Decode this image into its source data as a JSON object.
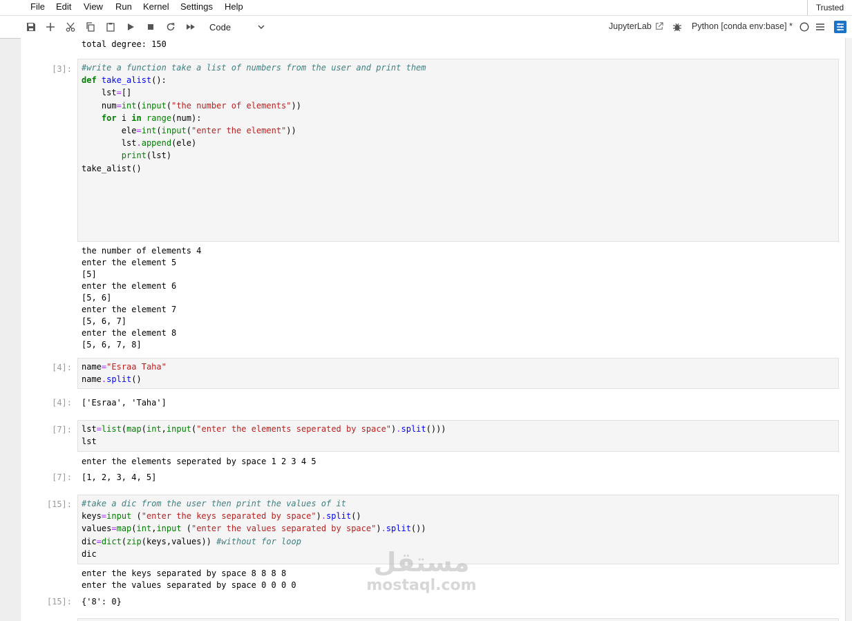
{
  "menu": [
    "File",
    "Edit",
    "View",
    "Run",
    "Kernel",
    "Settings",
    "Help"
  ],
  "trusted": "Trusted",
  "toolbar": {
    "cell_type": "Code",
    "jupyterlab": "JupyterLab",
    "kernel": "Python [conda env:base] *"
  },
  "cells": {
    "prev_output": "total degree: 150",
    "c3_prompt": "[3]:",
    "c3_output": [
      "the number of elements 4",
      "enter the element 5",
      "[5]",
      "enter the element 6",
      "[5, 6]",
      "enter the element 7",
      "[5, 6, 7]",
      "enter the element 8",
      "[5, 6, 7, 8]"
    ],
    "c4_prompt": "[4]:",
    "c4_out_prompt": "[4]:",
    "c4_result": "['Esraa', 'Taha']",
    "c7_prompt": "[7]:",
    "c7_stdout": "enter the elements seperated by space 1 2 3 4 5",
    "c7_out_prompt": "[7]:",
    "c7_result": "[1, 2, 3, 4, 5]",
    "c15_prompt": "[15]:",
    "c15_stdout": [
      "enter the keys separated by space 8 8 8 8",
      "enter the values separated by space 0 0 0 0"
    ],
    "c15_out_prompt": "[15]:",
    "c15_result": "{'8': 0}"
  },
  "code": {
    "c3": {
      "comment": "#write a function take a list of numbers from the user and print them",
      "def": "def",
      "fname": "take_alist",
      "prompt1": "\"the number of elements\"",
      "prompt2": "\"enter the element\"",
      "call": "take_alist()"
    },
    "c4": {
      "str": "\"Esraa Taha\""
    },
    "c7": {
      "str": "\"enter the elements seperated by space\""
    },
    "c15": {
      "comment": "#take a dic from the user then print the values of it",
      "keys_str": "\"enter the keys separated by space\"",
      "vals_str": "\"enter the values separated by space\"",
      "comment2": "#without for loop"
    }
  },
  "watermark": {
    "arabic": "مستقل",
    "latin": "mostaql.com"
  }
}
